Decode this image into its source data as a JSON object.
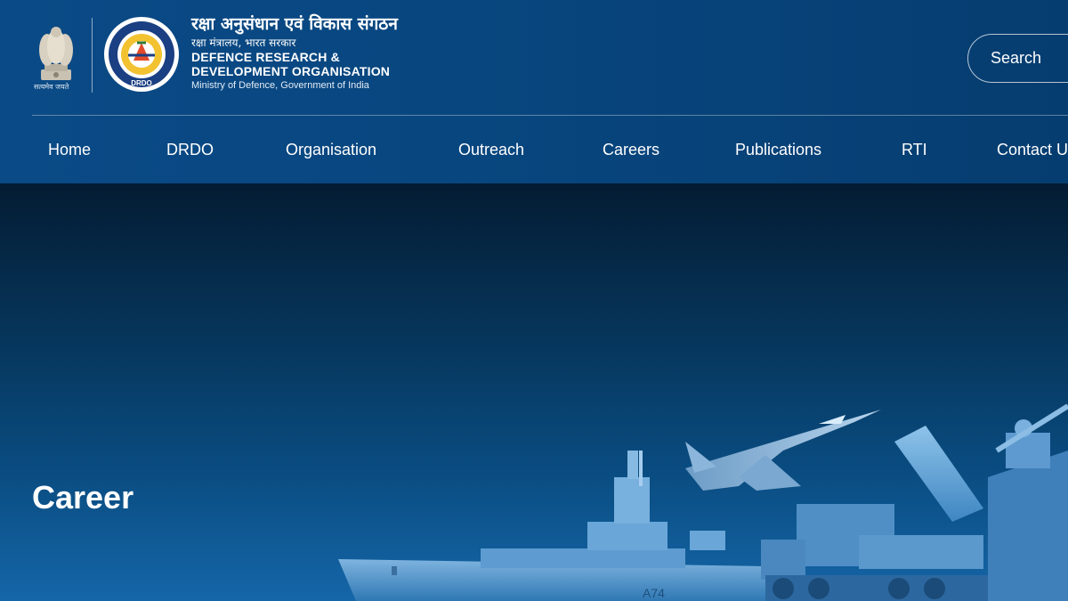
{
  "header": {
    "emblem_motto": "सत्यमेव जयते",
    "org_name_hindi": "रक्षा अनुसंधान एवं विकास संगठन",
    "ministry_hindi": "रक्षा मंत्रालय, भारत सरकार",
    "org_name_en_line1": "DEFENCE RESEARCH &",
    "org_name_en_line2": "DEVELOPMENT ORGANISATION",
    "ministry_en": "Ministry of Defence, Government of India",
    "logo_text": "DRDO",
    "search_label": "Search"
  },
  "nav": {
    "items": [
      {
        "label": "Home"
      },
      {
        "label": "DRDO"
      },
      {
        "label": "Organisation"
      },
      {
        "label": "Outreach"
      },
      {
        "label": "Careers"
      },
      {
        "label": "Publications"
      },
      {
        "label": "RTI"
      },
      {
        "label": "Contact U"
      }
    ]
  },
  "hero": {
    "title": "Career",
    "ship_number": "A74"
  },
  "colors": {
    "header_bg": "#0a4a86",
    "hero_dark": "#041c33",
    "hero_light": "#1566a8",
    "text": "#ffffff"
  },
  "icons": [
    "national-emblem-icon",
    "drdo-logo-icon"
  ]
}
